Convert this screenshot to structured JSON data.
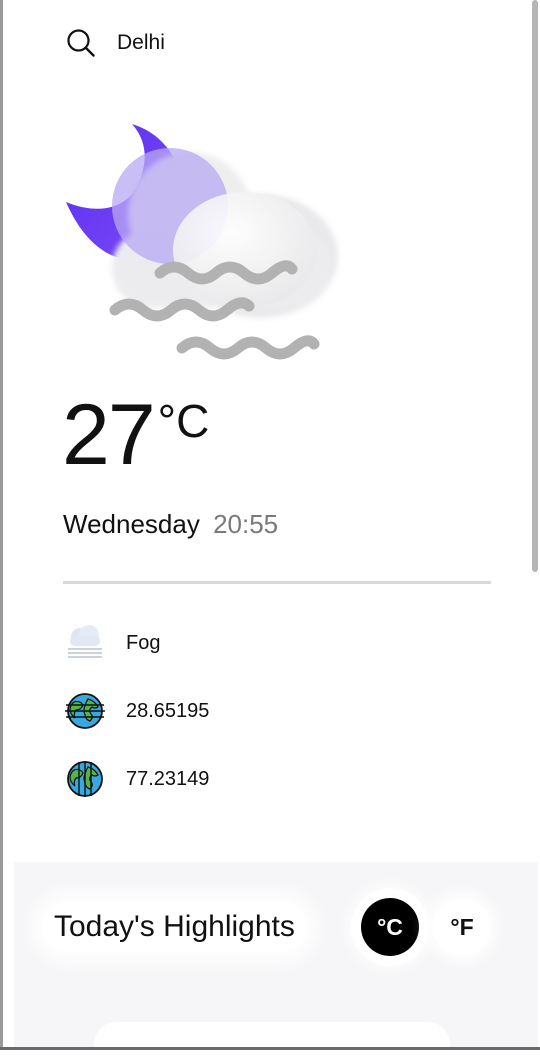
{
  "search": {
    "location": "Delhi"
  },
  "weather": {
    "temperature": "27",
    "unit": "°C",
    "day": "Wednesday",
    "time": "20:55",
    "condition": "Fog",
    "latitude": "28.65195",
    "longitude": "77.23149"
  },
  "highlights": {
    "title": "Today's Highlights",
    "celsius_label": "°C",
    "fahrenheit_label": "°F"
  },
  "icons": {
    "search": "search-icon",
    "hero": "moon-cloud-fog-icon",
    "condition": "fog-icon",
    "latitude": "globe-icon",
    "longitude": "globe-icon"
  },
  "colors": {
    "moon": "#6a3df0",
    "active_unit_bg": "#000000",
    "muted_text": "#7a7a7a"
  }
}
